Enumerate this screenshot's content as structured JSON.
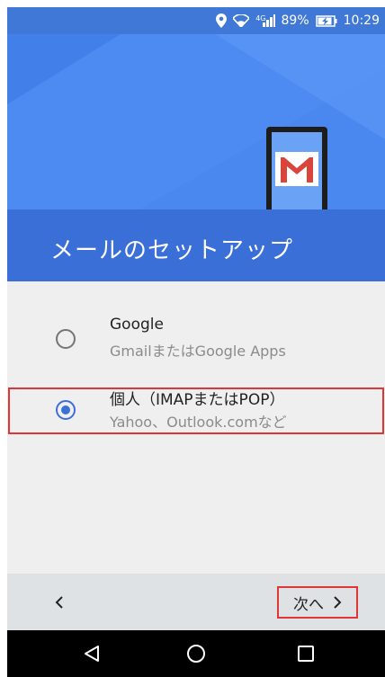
{
  "status_bar": {
    "network_label": "4G",
    "battery_percent": "89%",
    "time": "10:29"
  },
  "header": {
    "title": "メールのセットアップ"
  },
  "options": [
    {
      "title": "Google",
      "subtitle": "GmailまたはGoogle Apps",
      "selected": false
    },
    {
      "title": "個人（IMAPまたはPOP）",
      "subtitle": "Yahoo、Outlook.comなど",
      "selected": true
    }
  ],
  "bottom_bar": {
    "next_label": "次へ"
  },
  "colors": {
    "header_blue": "#4a88f0",
    "radio_selected": "#3d6fd8",
    "highlight_red": "#e23636"
  }
}
